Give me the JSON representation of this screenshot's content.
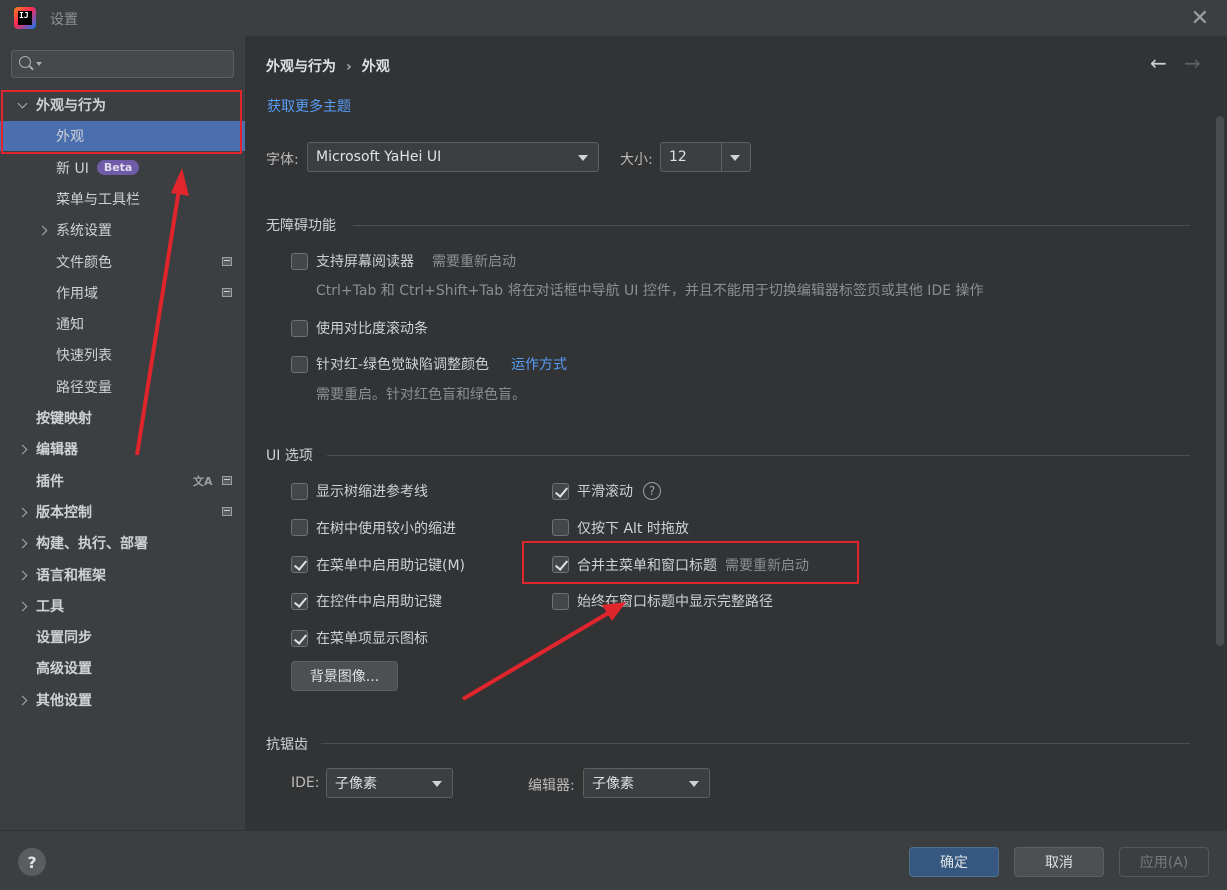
{
  "window": {
    "title": "设置"
  },
  "sidebar": {
    "items": [
      {
        "label": "外观与行为",
        "level": 0,
        "expanded": true,
        "bold": true
      },
      {
        "label": "外观",
        "level": 1,
        "selected": true
      },
      {
        "label": "新 UI",
        "level": 1,
        "badge": "Beta"
      },
      {
        "label": "菜单与工具栏",
        "level": 1
      },
      {
        "label": "系统设置",
        "level": 1,
        "collapsed": true
      },
      {
        "label": "文件颜色",
        "level": 1,
        "icon": "project-icon"
      },
      {
        "label": "作用域",
        "level": 1,
        "icon": "project-icon"
      },
      {
        "label": "通知",
        "level": 1
      },
      {
        "label": "快速列表",
        "level": 1
      },
      {
        "label": "路径变量",
        "level": 1
      },
      {
        "label": "按键映射",
        "level": 0,
        "bold": true
      },
      {
        "label": "编辑器",
        "level": 0,
        "collapsed": true,
        "bold": true
      },
      {
        "label": "插件",
        "level": 0,
        "bold": true,
        "icon": "translate-icon"
      },
      {
        "label": "版本控制",
        "level": 0,
        "collapsed": true,
        "bold": true,
        "icon": "project-icon"
      },
      {
        "label": "构建、执行、部署",
        "level": 0,
        "collapsed": true,
        "bold": true
      },
      {
        "label": "语言和框架",
        "level": 0,
        "collapsed": true,
        "bold": true
      },
      {
        "label": "工具",
        "level": 0,
        "collapsed": true,
        "bold": true
      },
      {
        "label": "设置同步",
        "level": 0,
        "bold": true
      },
      {
        "label": "高级设置",
        "level": 0,
        "bold": true
      },
      {
        "label": "其他设置",
        "level": 0,
        "collapsed": true,
        "bold": true
      }
    ]
  },
  "breadcrumb": {
    "parent": "外观与行为",
    "sep": "›",
    "current": "外观"
  },
  "nav": {
    "back": "←",
    "forward": "→"
  },
  "get_themes_link": "获取更多主题",
  "font": {
    "label": "字体:",
    "value": "Microsoft YaHei UI",
    "size_label": "大小:",
    "size_value": "12"
  },
  "accessibility": {
    "title": "无障碍功能",
    "screen_reader": {
      "label": "支持屏幕阅读器",
      "hint": "需要重新启动",
      "desc": "Ctrl+Tab 和 Ctrl+Shift+Tab 将在对话框中导航 UI 控件，并且不能用于切换编辑器标签页或其他 IDE 操作",
      "checked": false
    },
    "contrast_scrollbar": {
      "label": "使用对比度滚动条",
      "checked": false
    },
    "color_deficiency": {
      "label": "针对红-绿色觉缺陷调整颜色",
      "link": "运作方式",
      "desc": "需要重启。针对红色盲和绿色盲。",
      "checked": false
    }
  },
  "ui_options": {
    "title": "UI 选项",
    "left": [
      {
        "label": "显示树缩进参考线",
        "checked": false
      },
      {
        "label": "在树中使用较小的缩进",
        "checked": false
      },
      {
        "label": "在菜单中启用助记键(M)",
        "checked": true
      },
      {
        "label": "在控件中启用助记键",
        "checked": true
      },
      {
        "label": "在菜单项显示图标",
        "checked": true
      }
    ],
    "right": [
      {
        "label": "平滑滚动",
        "checked": true,
        "help": "?"
      },
      {
        "label": "仅按下 Alt 时拖放",
        "checked": false
      },
      {
        "label": "合并主菜单和窗口标题",
        "checked": true,
        "hint": "需要重新启动"
      },
      {
        "label": "始终在窗口标题中显示完整路径",
        "checked": false
      }
    ],
    "background_button": "背景图像..."
  },
  "antialiasing": {
    "title": "抗锯齿",
    "ide_label": "IDE:",
    "ide_value": "子像素",
    "editor_label": "编辑器:",
    "editor_value": "子像素"
  },
  "footer": {
    "help": "?",
    "ok": "确定",
    "cancel": "取消",
    "apply": "应用(A)"
  },
  "colors": {
    "selection": "#4b6eaf",
    "link": "#589df6",
    "primary_button": "#365880",
    "annotation_red": "#e0252c",
    "beta_badge": "#6f5ba7"
  }
}
